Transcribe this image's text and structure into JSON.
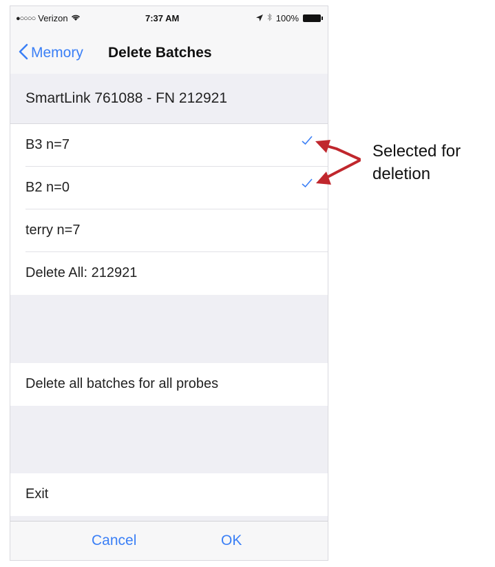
{
  "status_bar": {
    "signal": "●○○○○",
    "carrier": "Verizon",
    "wifi_icon": "wifi-icon",
    "time": "7:37 AM",
    "location_icon": "location-arrow-icon",
    "bluetooth_icon": "bluetooth-icon",
    "battery_text": "100%"
  },
  "nav": {
    "back_label": "Memory",
    "title": "Delete Batches"
  },
  "section_header": "SmartLink 761088 - FN 212921",
  "batches": [
    {
      "label": "B3  n=7",
      "selected": true
    },
    {
      "label": "B2  n=0",
      "selected": true
    },
    {
      "label": "terry  n=7",
      "selected": false
    }
  ],
  "delete_all_label": "Delete All: 212921",
  "delete_all_probes_label": "Delete all batches for all probes",
  "exit_label": "Exit",
  "toolbar": {
    "cancel_label": "Cancel",
    "ok_label": "OK"
  },
  "annotation": {
    "text": "Selected for deletion"
  },
  "colors": {
    "accent": "#3a7ff6",
    "arrow": "#c0272d"
  }
}
